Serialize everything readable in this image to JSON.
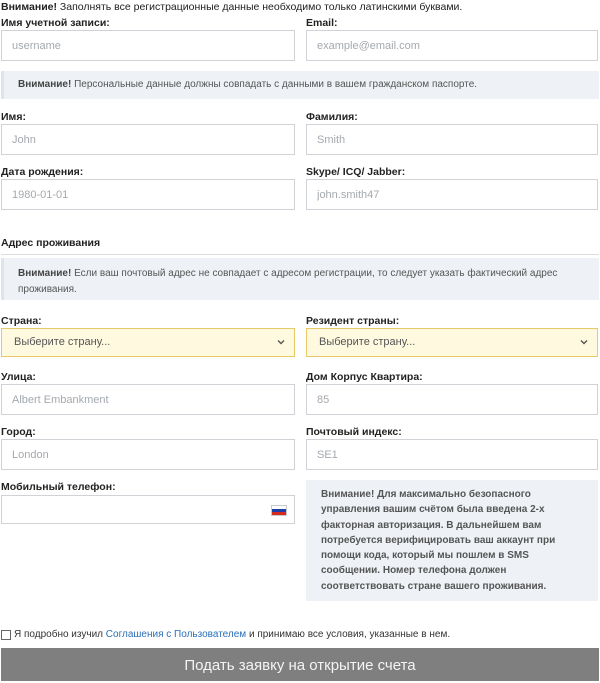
{
  "notice": {
    "bold": "Внимание!",
    "text": " Заполнять все регистрационные данные необходимо только латинскими буквами."
  },
  "fields": {
    "username": {
      "label": "Имя учетной записи:",
      "placeholder": "username"
    },
    "email": {
      "label": "Email:",
      "placeholder": "example@email.com"
    },
    "first_name": {
      "label": "Имя:",
      "placeholder": "John"
    },
    "last_name": {
      "label": "Фамилия:",
      "placeholder": "Smith"
    },
    "birth_date": {
      "label": "Дата рождения:",
      "placeholder": "1980-01-01"
    },
    "messenger": {
      "label": "Skype/ ICQ/ Jabber:",
      "placeholder": "john.smith47"
    },
    "street": {
      "label": "Улица:",
      "placeholder": "Albert Embankment"
    },
    "house": {
      "label": "Дом Корпус Квартира:",
      "placeholder": "85"
    },
    "city": {
      "label": "Город:",
      "placeholder": "London"
    },
    "postcode": {
      "label": "Почтовый индекс:",
      "placeholder": "SE1"
    },
    "phone": {
      "label": "Мобильный телефон:",
      "value": ""
    }
  },
  "passport_alert": {
    "bold": "Внимание!",
    "text": " Персональные данные должны совпадать с данными в вашем гражданском паспорте."
  },
  "address_section": {
    "title": "Адрес проживания",
    "alert_bold": "Внимание!",
    "alert_text": " Если ваш почтовый адрес не совпадает с адресом регистрации, то следует указать фактический адрес проживания."
  },
  "selects": {
    "country": {
      "label": "Страна:",
      "value": "Выберите страну..."
    },
    "resident": {
      "label": "Резидент страны:",
      "value": "Выберите страну..."
    }
  },
  "two_factor_info": "Внимание! Для максимально безопасного управления вашим счётом была введена 2-х факторная авторизация. В дальнейшем вам потребуется верифицировать ваш аккаунт при помощи кода, который мы пошлем в SMS сообщении. Номер телефона должен соответствовать стране вашего проживания.",
  "agreement": {
    "prefix": "Я подробно изучил ",
    "link": "Соглашения с Пользователем",
    "suffix": " и принимаю все условия, указанные в нем.",
    "checked": false
  },
  "submit_label": "Подать заявку на открытие счета",
  "icons": {
    "flag": "russia-flag-icon",
    "chevron": "chevron-down-icon"
  },
  "colors": {
    "submit_bg": "#7f7f7f",
    "select_bg": "#fff9e0",
    "select_border": "#e8c96a",
    "link": "#2a6fb8"
  }
}
